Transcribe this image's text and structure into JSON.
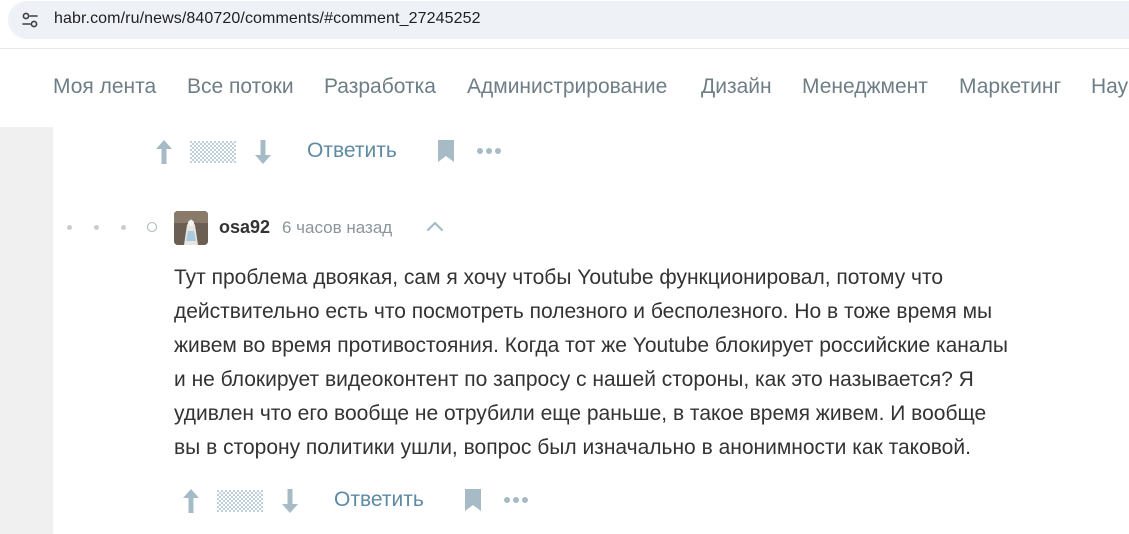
{
  "browser": {
    "url": "habr.com/ru/news/840720/comments/#comment_27245252",
    "site_icon": "site-settings-icon"
  },
  "nav": {
    "items": [
      {
        "label": "Моя лента"
      },
      {
        "label": "Все потоки"
      },
      {
        "label": "Разработка"
      },
      {
        "label": "Администрирование"
      },
      {
        "label": "Дизайн"
      },
      {
        "label": "Менеджмент"
      },
      {
        "label": "Маркетинг"
      },
      {
        "label": "Нау"
      }
    ]
  },
  "prev_comment": {
    "actions": {
      "upvote_icon": "arrow-up-icon",
      "score_icon": "hidden-score-icon",
      "downvote_icon": "arrow-down-icon",
      "reply_label": "Ответить",
      "bookmark_icon": "bookmark-icon",
      "more_icon": "more-icon"
    }
  },
  "comment": {
    "author": "osa92",
    "time": "6 часов назад",
    "collapse_icon": "chevron-up-icon",
    "lines": [
      "Тут проблема двоякая, сам я хочу чтобы Youtube функционировал, потому что",
      "действительно есть что посмотреть полезного и бесполезного. Но в тоже время мы",
      "живем во время противостояния. Когда тот же Youtube блокирует российские каналы",
      "и не блокирует видеоконтент по запросу с нашей стороны, как это называется? Я",
      "удивлен что его вообще не отрубили еще раньше, в такое время живем. И вообще",
      "вы в сторону политики ушли, вопрос был изначально в анонимности как таковой."
    ],
    "actions": {
      "reply_label": "Ответить"
    }
  },
  "colors": {
    "nav_text": "#6e7e86",
    "reply_link": "#5e8aa3",
    "icon": "#a7bbc7",
    "gutter": "#f0f0f0"
  }
}
